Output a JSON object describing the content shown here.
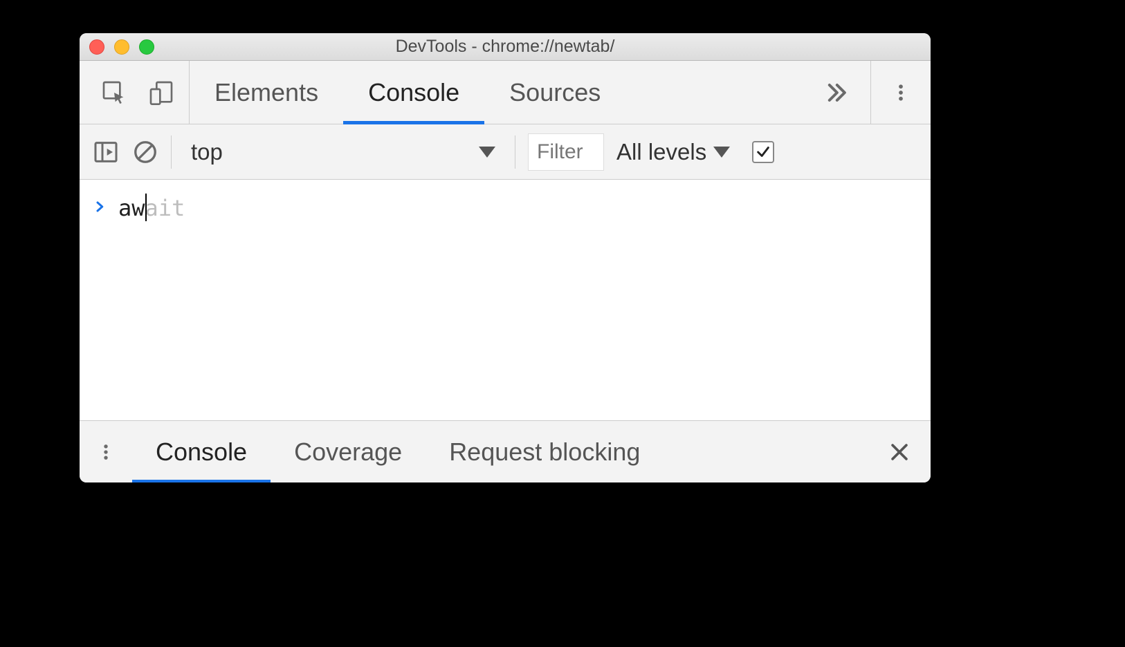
{
  "window": {
    "title": "DevTools - chrome://newtab/"
  },
  "tabs": {
    "elements": "Elements",
    "console": "Console",
    "sources": "Sources"
  },
  "console_toolbar": {
    "context": "top",
    "filter_placeholder": "Filter",
    "levels_label": "All levels"
  },
  "console_input": {
    "typed": "aw",
    "suggestion": "ait"
  },
  "drawer": {
    "console": "Console",
    "coverage": "Coverage",
    "request_blocking": "Request blocking"
  }
}
